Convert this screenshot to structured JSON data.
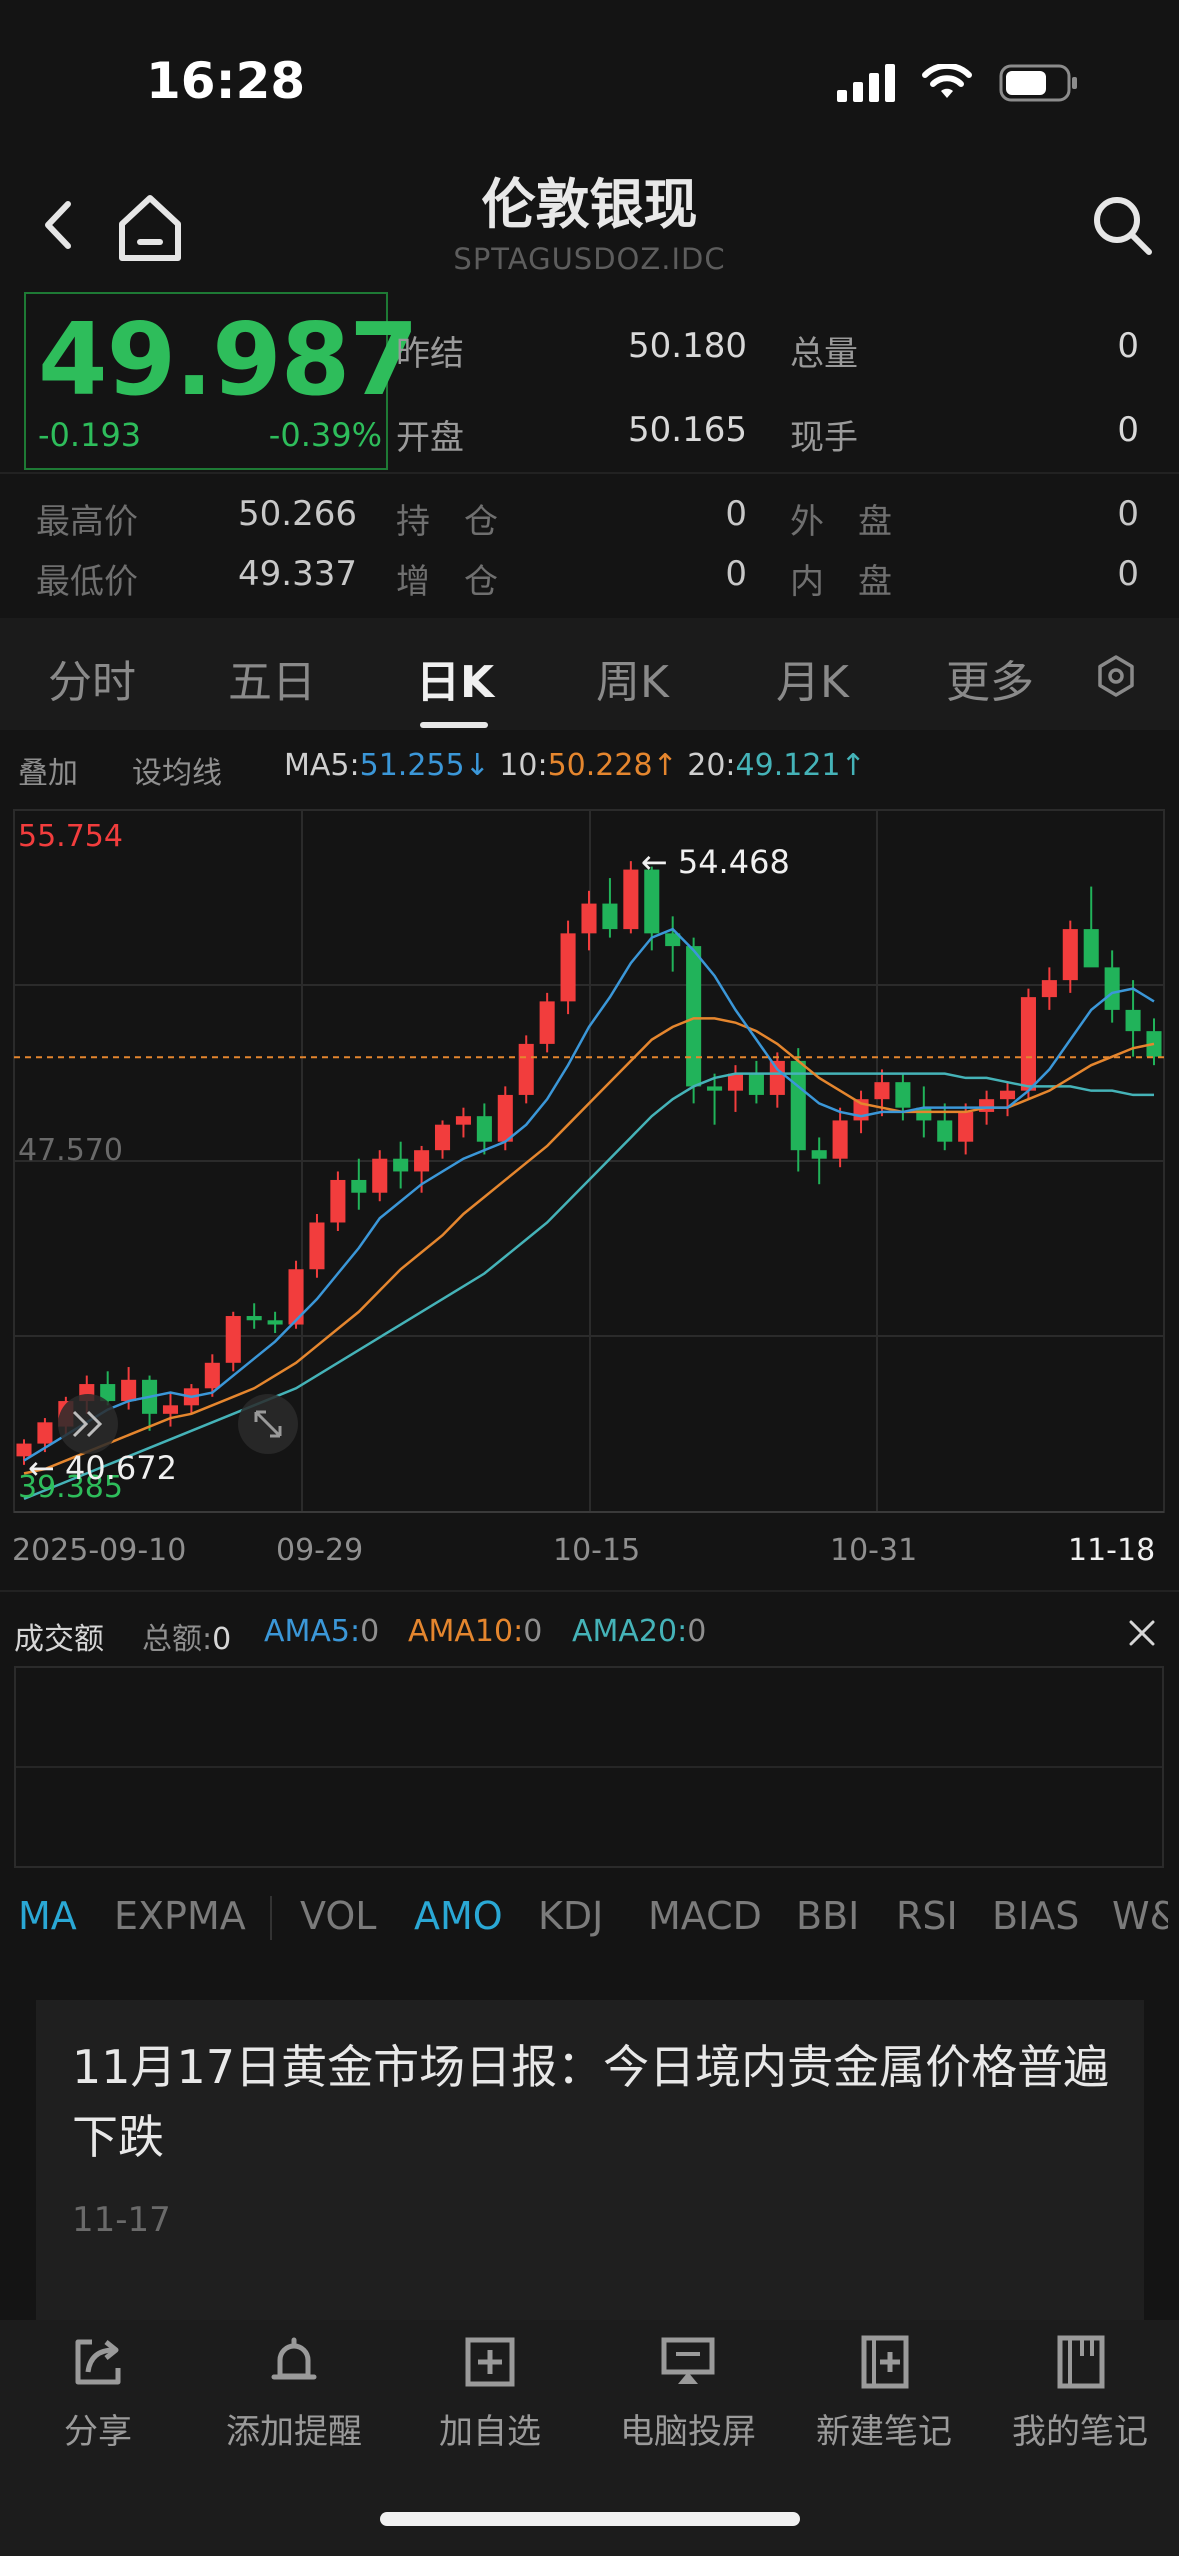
{
  "status_bar": {
    "time": "16:28"
  },
  "header": {
    "title": "伦敦银现",
    "code": "SPTAGUSDOZ.IDC"
  },
  "quote": {
    "price": "49.987",
    "change": "-0.193",
    "change_pct": "-0.39%",
    "stats": [
      {
        "label": "昨结",
        "value": "50.180"
      },
      {
        "label": "总量",
        "value": "0"
      },
      {
        "label": "开盘",
        "value": "50.165"
      },
      {
        "label": "现手",
        "value": "0"
      },
      {
        "label": "最高价",
        "value": "50.266"
      },
      {
        "label": "持　仓",
        "value": "0"
      },
      {
        "label": "外　盘",
        "value": "0"
      },
      {
        "label": "最低价",
        "value": "49.337"
      },
      {
        "label": "增　仓",
        "value": "0"
      },
      {
        "label": "内　盘",
        "value": "0"
      }
    ]
  },
  "tabs": [
    "分时",
    "五日",
    "日K",
    "周K",
    "月K",
    "更多"
  ],
  "active_tab": "日K",
  "indicator_bar": {
    "overlay": "叠加",
    "set_ma": "设均线",
    "ma5_label": "MA5:",
    "ma5_value": "51.255",
    "ma5_arrow": "↓",
    "ma10_label": "10:",
    "ma10_value": "50.228",
    "ma10_arrow": "↑",
    "ma20_label": "20:",
    "ma20_value": "49.121",
    "ma20_arrow": "↑"
  },
  "chart_data": {
    "type": "candlestick",
    "y_top_label": "55.754",
    "y_mid_label": "47.570",
    "y_bottom_label": "39.385",
    "high_marker": "54.468",
    "low_marker": "40.672",
    "x_labels": [
      "2025-09-10",
      "09-29",
      "10-15",
      "10-31",
      "11-18"
    ],
    "ylim": [
      39.385,
      55.754
    ],
    "current_price": 49.987,
    "colors": {
      "up": "#f23d3d",
      "down": "#21b35a",
      "ma5": "#3b97d8",
      "ma10": "#e5862e",
      "ma20": "#45b3b8"
    },
    "candles": [
      [
        40.6,
        41.0,
        40.4,
        40.9
      ],
      [
        40.9,
        41.5,
        40.7,
        41.4
      ],
      [
        41.3,
        42.0,
        41.1,
        41.9
      ],
      [
        41.9,
        42.5,
        41.6,
        42.3
      ],
      [
        42.3,
        42.6,
        41.8,
        41.9
      ],
      [
        41.9,
        42.7,
        41.7,
        42.4
      ],
      [
        42.4,
        42.5,
        41.2,
        41.6
      ],
      [
        41.6,
        42.1,
        41.3,
        41.8
      ],
      [
        41.8,
        42.3,
        41.6,
        42.2
      ],
      [
        42.2,
        43.0,
        42.0,
        42.8
      ],
      [
        42.8,
        44.0,
        42.6,
        43.9
      ],
      [
        43.9,
        44.2,
        43.6,
        43.8
      ],
      [
        43.8,
        44.0,
        43.5,
        43.7
      ],
      [
        43.7,
        45.2,
        43.6,
        45.0
      ],
      [
        45.0,
        46.3,
        44.8,
        46.1
      ],
      [
        46.1,
        47.3,
        45.9,
        47.1
      ],
      [
        47.1,
        47.6,
        46.4,
        46.8
      ],
      [
        46.8,
        47.8,
        46.6,
        47.6
      ],
      [
        47.6,
        48.0,
        46.9,
        47.3
      ],
      [
        47.3,
        47.9,
        46.8,
        47.8
      ],
      [
        47.8,
        48.5,
        47.6,
        48.4
      ],
      [
        48.4,
        48.8,
        48.1,
        48.6
      ],
      [
        48.6,
        48.9,
        47.7,
        48.0
      ],
      [
        48.0,
        49.3,
        47.8,
        49.1
      ],
      [
        49.1,
        50.5,
        48.9,
        50.3
      ],
      [
        50.3,
        51.5,
        50.1,
        51.3
      ],
      [
        51.3,
        53.2,
        51.0,
        52.9
      ],
      [
        52.9,
        53.9,
        52.5,
        53.6
      ],
      [
        53.6,
        54.2,
        52.8,
        53.0
      ],
      [
        53.0,
        54.6,
        52.9,
        54.4
      ],
      [
        54.4,
        54.468,
        52.5,
        52.9
      ],
      [
        52.9,
        53.3,
        52.0,
        52.6
      ],
      [
        52.6,
        52.8,
        48.9,
        49.3
      ],
      [
        49.3,
        49.6,
        48.4,
        49.2
      ],
      [
        49.2,
        49.8,
        48.7,
        49.6
      ],
      [
        49.6,
        49.9,
        48.9,
        49.1
      ],
      [
        49.1,
        50.1,
        48.8,
        49.9
      ],
      [
        49.9,
        50.2,
        47.3,
        47.8
      ],
      [
        47.8,
        48.1,
        47.0,
        47.6
      ],
      [
        47.6,
        48.8,
        47.4,
        48.5
      ],
      [
        48.5,
        49.2,
        48.2,
        49.0
      ],
      [
        49.0,
        49.7,
        48.6,
        49.4
      ],
      [
        49.4,
        49.6,
        48.5,
        48.8
      ],
      [
        48.8,
        49.3,
        48.1,
        48.5
      ],
      [
        48.5,
        48.9,
        47.8,
        48.0
      ],
      [
        48.0,
        48.9,
        47.7,
        48.7
      ],
      [
        48.7,
        49.2,
        48.4,
        49.0
      ],
      [
        49.0,
        49.4,
        48.6,
        49.2
      ],
      [
        49.2,
        51.6,
        49.0,
        51.4
      ],
      [
        51.4,
        52.1,
        51.1,
        51.8
      ],
      [
        51.8,
        53.2,
        51.5,
        53.0
      ],
      [
        53.0,
        54.0,
        52.5,
        52.1
      ],
      [
        52.1,
        52.5,
        50.8,
        51.1
      ],
      [
        51.1,
        51.8,
        50.0,
        50.6
      ],
      [
        50.6,
        50.9,
        49.8,
        50.0
      ]
    ],
    "ma5": [
      40.5,
      40.8,
      41.1,
      41.4,
      41.7,
      41.9,
      42.0,
      42.1,
      42.0,
      42.1,
      42.5,
      42.9,
      43.3,
      43.8,
      44.3,
      44.9,
      45.5,
      46.2,
      46.6,
      47.0,
      47.3,
      47.6,
      47.8,
      48.0,
      48.4,
      49.0,
      49.8,
      50.7,
      51.4,
      52.2,
      52.8,
      53.0,
      52.5,
      51.9,
      51.1,
      50.4,
      49.7,
      49.3,
      48.9,
      48.7,
      48.6,
      48.7,
      48.7,
      48.8,
      48.8,
      48.8,
      48.8,
      48.8,
      49.2,
      49.7,
      50.4,
      51.1,
      51.5,
      51.6,
      51.3
    ],
    "ma10": [
      40.2,
      40.3,
      40.5,
      40.7,
      40.9,
      41.1,
      41.3,
      41.5,
      41.6,
      41.8,
      42.0,
      42.2,
      42.5,
      42.8,
      43.2,
      43.6,
      44.0,
      44.5,
      45.0,
      45.4,
      45.8,
      46.3,
      46.7,
      47.1,
      47.5,
      47.9,
      48.4,
      48.9,
      49.4,
      49.9,
      50.4,
      50.7,
      50.9,
      50.9,
      50.8,
      50.6,
      50.3,
      49.9,
      49.5,
      49.2,
      48.9,
      48.8,
      48.7,
      48.7,
      48.7,
      48.7,
      48.8,
      48.8,
      49.0,
      49.2,
      49.5,
      49.8,
      50.0,
      50.2,
      50.3
    ],
    "ma20": [
      39.6,
      39.8,
      40.0,
      40.2,
      40.4,
      40.6,
      40.8,
      41.0,
      41.2,
      41.4,
      41.6,
      41.8,
      42.0,
      42.2,
      42.5,
      42.8,
      43.1,
      43.4,
      43.7,
      44.0,
      44.3,
      44.6,
      44.9,
      45.3,
      45.7,
      46.1,
      46.6,
      47.1,
      47.6,
      48.1,
      48.6,
      49.0,
      49.3,
      49.5,
      49.6,
      49.6,
      49.6,
      49.6,
      49.6,
      49.6,
      49.6,
      49.6,
      49.6,
      49.6,
      49.6,
      49.5,
      49.5,
      49.4,
      49.3,
      49.3,
      49.3,
      49.2,
      49.2,
      49.1,
      49.1
    ]
  },
  "volume": {
    "title": "成交额",
    "total_label": "总额:",
    "total_value": "0",
    "ama5_label": "AMA5:",
    "ama5_value": "0",
    "ama10_label": "AMA10:",
    "ama10_value": "0",
    "ama20_label": "AMA20:",
    "ama20_value": "0"
  },
  "indicator_tabs": [
    "MA",
    "EXPMA",
    "VOL",
    "AMO",
    "KDJ",
    "MACD",
    "BBI",
    "RSI",
    "BIAS",
    "W&"
  ],
  "news": {
    "title": "11月17日黄金市场日报：今日境内贵金属价格普遍下跌",
    "date": "11-17"
  },
  "toolbar": [
    {
      "label": "分享",
      "icon": "share-icon"
    },
    {
      "label": "添加提醒",
      "icon": "bell-icon"
    },
    {
      "label": "加自选",
      "icon": "plus-square-icon"
    },
    {
      "label": "电脑投屏",
      "icon": "screen-cast-icon"
    },
    {
      "label": "新建笔记",
      "icon": "new-note-icon"
    },
    {
      "label": "我的笔记",
      "icon": "notebook-icon"
    }
  ]
}
